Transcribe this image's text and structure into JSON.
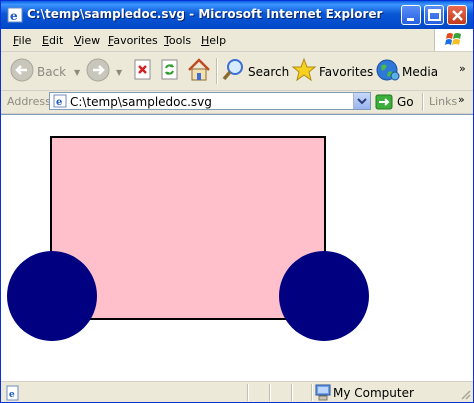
{
  "window": {
    "title": "C:\\temp\\sampledoc.svg - Microsoft Internet Explorer"
  },
  "menu": {
    "items": [
      {
        "first": "F",
        "rest": "ile"
      },
      {
        "first": "E",
        "rest": "dit"
      },
      {
        "first": "V",
        "rest": "iew"
      },
      {
        "first": "F",
        "rest": "avorites"
      },
      {
        "first": "T",
        "rest": "ools"
      },
      {
        "first": "H",
        "rest": "elp"
      }
    ]
  },
  "toolbar": {
    "back_label": "Back",
    "search_label": "Search",
    "favorites_label": "Favorites",
    "media_label": "Media"
  },
  "address": {
    "label": "Address",
    "url": "C:\\temp\\sampledoc.svg",
    "go_label": "Go",
    "links_label": "Links",
    "more": "»"
  },
  "document": {
    "rect_fill": "#ffc0cb",
    "circle_fill": "#000080",
    "stroke": "#000000"
  },
  "status": {
    "zone": "My Computer"
  }
}
